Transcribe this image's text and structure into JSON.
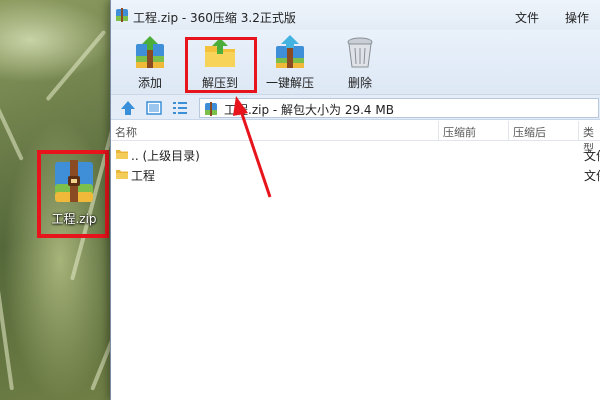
{
  "window": {
    "title": "工程.zip - 360压缩 3.2正式版",
    "menu": [
      "文件",
      "操作"
    ]
  },
  "toolbar": {
    "add_label": "添加",
    "extract_to_label": "解压到",
    "one_click_extract_label": "一键解压",
    "delete_label": "删除"
  },
  "address": {
    "path": "工程.zip - 解包大小为 29.4 MB"
  },
  "columns": {
    "name": "名称",
    "before": "压缩前",
    "after": "压缩后",
    "type": "类型"
  },
  "files": [
    {
      "name": ".. (上级目录)",
      "type": "文件夹"
    },
    {
      "name": "工程",
      "type": "文件夹"
    }
  ],
  "desktop": {
    "icon_label": "工程.zip"
  },
  "colors": {
    "highlight": "#e8141c",
    "toolbar_bg": "#e3ecf6"
  }
}
